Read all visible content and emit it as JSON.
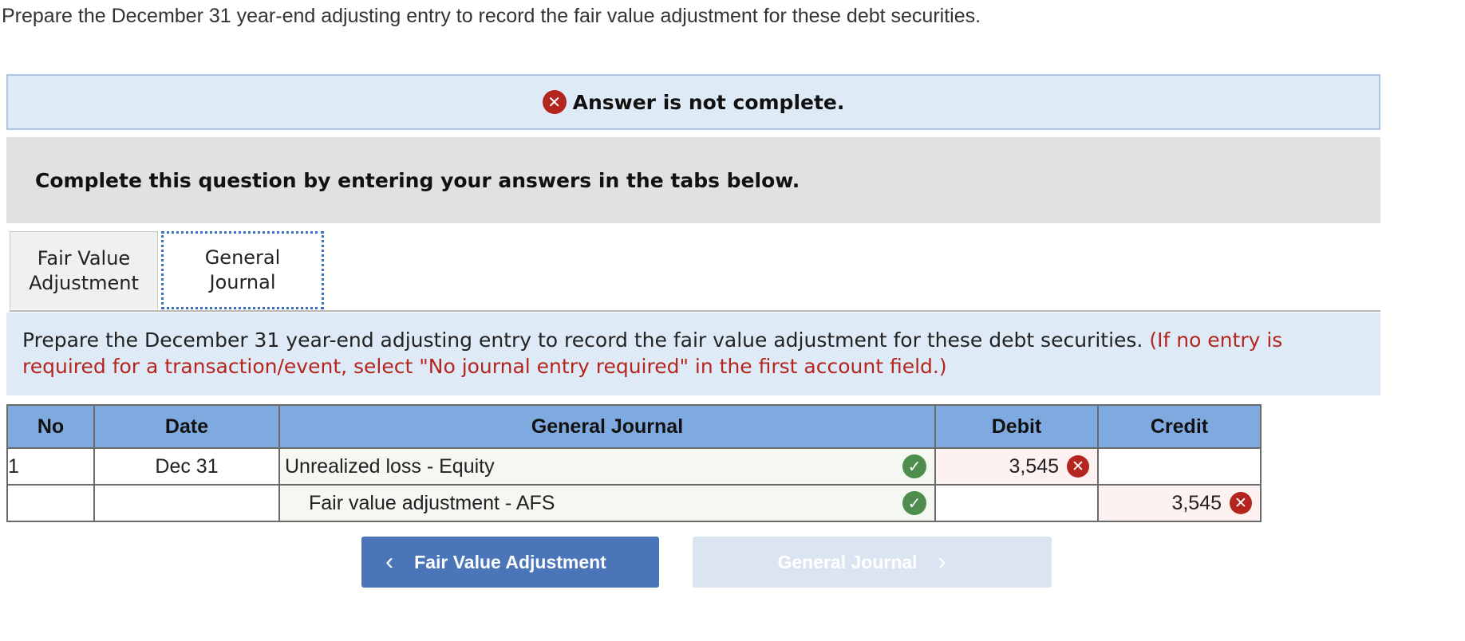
{
  "prompt": "Prepare the December 31 year-end adjusting entry to record the fair value adjustment for these debt securities.",
  "alert": {
    "text": "Answer is not complete.",
    "icon": "x-circle-icon",
    "color": "#b3251e"
  },
  "instructions": "Complete this question by entering your answers in the tabs below.",
  "tabs": [
    {
      "label": "Fair Value\nAdjustment",
      "active": false
    },
    {
      "label": "General\nJournal",
      "active": true
    }
  ],
  "requirement": {
    "text": "Prepare the December 31 year-end adjusting entry to record the fair value adjustment for these debt securities.",
    "note": "(If no entry is required for a transaction/event, select \"No journal entry required\" in the first account field.)"
  },
  "table": {
    "headers": {
      "no": "No",
      "date": "Date",
      "account": "General Journal",
      "debit": "Debit",
      "credit": "Credit"
    },
    "rows": [
      {
        "no": "1",
        "date": "Dec 31",
        "account": "Unrealized loss - Equity",
        "account_status": "correct",
        "debit": "3,545",
        "debit_status": "incorrect",
        "credit": ""
      },
      {
        "no": "",
        "date": "",
        "account": "Fair value adjustment - AFS",
        "account_status": "correct",
        "debit": "",
        "credit": "3,545",
        "credit_status": "incorrect"
      }
    ]
  },
  "nav": {
    "prev_label": "Fair Value Adjustment",
    "next_label": "General Journal"
  },
  "colors": {
    "header_bg": "#7faae0",
    "nav_active": "#4a76b9",
    "nav_disabled": "#dbe5f1",
    "correct": "#4f8d4f",
    "incorrect": "#b3251e"
  }
}
